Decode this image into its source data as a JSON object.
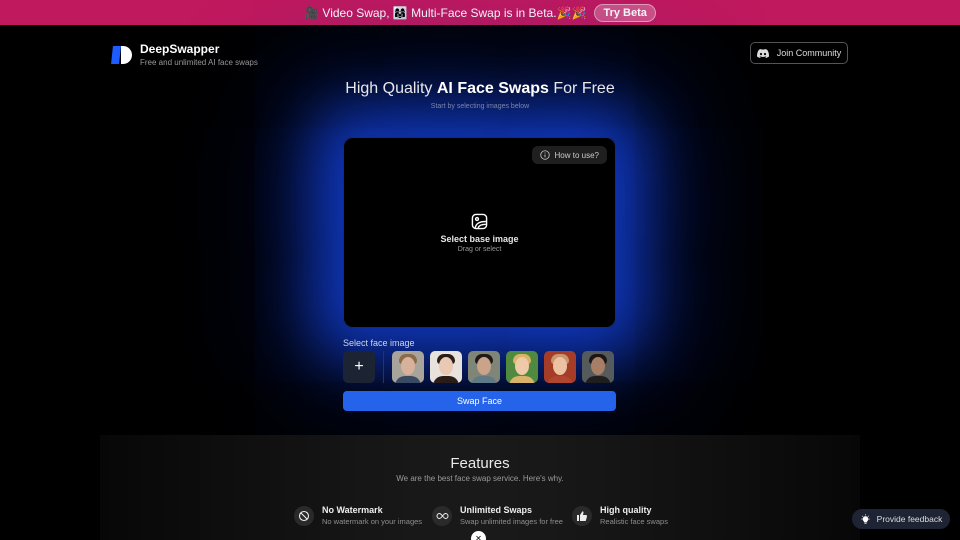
{
  "announcement": {
    "text": "🎥 Video Swap, 👩‍👩‍👧 Multi-Face Swap is in Beta.🎉🎉",
    "button_label": "Try Beta"
  },
  "header": {
    "brand_name": "DeepSwapper",
    "tagline": "Free and unlimited AI face swaps",
    "community_button": "Join Community",
    "community_icon": "discord-icon"
  },
  "hero": {
    "title_prefix": "High Quality ",
    "title_bold": "AI Face Swaps",
    "title_suffix": " For Free",
    "subtitle": "Start by selecting images below"
  },
  "dropzone": {
    "howto_label": "How to use?",
    "howto_icon": "info-icon",
    "title": "Select base image",
    "subtitle": "Drag or select",
    "icon": "image-icon"
  },
  "face_selector": {
    "label": "Select face image",
    "add_label": "+",
    "faces": [
      {
        "name": "face-1",
        "bg": "#a8a49c",
        "skin": "#d8b19a",
        "hair": "#8a6a48",
        "cloth": "#3b4a63"
      },
      {
        "name": "face-2",
        "bg": "#e7e2dc",
        "skin": "#e9c8b4",
        "hair": "#2a1c18",
        "cloth": "#2a1c18"
      },
      {
        "name": "face-3",
        "bg": "#7f8577",
        "skin": "#c9a38a",
        "hair": "#221a16",
        "cloth": "#5f7a86"
      },
      {
        "name": "face-4",
        "bg": "#4f8a3e",
        "skin": "#efcaa9",
        "hair": "#d9b36a",
        "cloth": "#d9b36a"
      },
      {
        "name": "face-5",
        "bg": "#a43c28",
        "skin": "#edc2a2",
        "hair": "#c99670",
        "cloth": "#b1452f"
      },
      {
        "name": "face-6",
        "bg": "#555a5c",
        "skin": "#a77e66",
        "hair": "#1b1614",
        "cloth": "#1e1e1e"
      }
    ]
  },
  "swap_button": "Swap Face",
  "features": {
    "title": "Features",
    "subtitle": "We are the best face swap service. Here's why.",
    "items": [
      {
        "icon": "no-watermark-icon",
        "name": "No Watermark",
        "desc": "No watermark on your images"
      },
      {
        "icon": "infinity-icon",
        "name": "Unlimited Swaps",
        "desc": "Swap unlimited images for free"
      },
      {
        "icon": "thumbs-up-icon",
        "name": "High quality",
        "desc": "Realistic face swaps"
      }
    ]
  },
  "feedback_button": "Provide feedback",
  "colors": {
    "announcement_bg": "#c0195e",
    "accent": "#2563eb",
    "glow": "#1446e6"
  }
}
